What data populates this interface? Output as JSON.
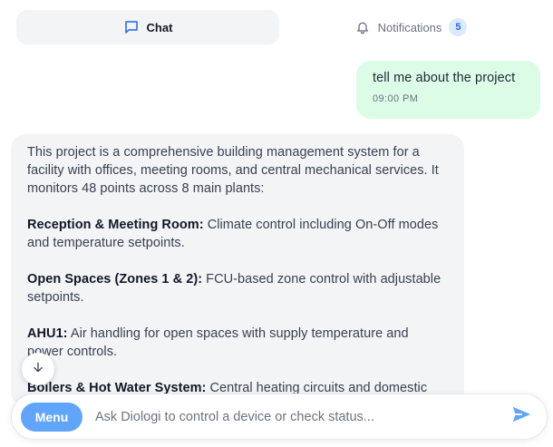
{
  "tabs": {
    "chat": {
      "label": "Chat",
      "icon": "chat-bubble-icon"
    },
    "notifications": {
      "label": "Notifications",
      "icon": "bell-icon",
      "count": "5"
    }
  },
  "messages": {
    "user": {
      "text": "tell me about the project",
      "time": "09:00 PM"
    },
    "assistant": {
      "intro": "This project is a comprehensive building management system for a facility with offices, meeting rooms, and central mechanical services. It monitors 48 points across 8 main plants:",
      "sections": [
        {
          "title": "Reception & Meeting Room:",
          "text": "Climate control including On-Off modes and temperature setpoints."
        },
        {
          "title": "Open Spaces (Zones 1 & 2):",
          "text": "FCU-based zone control with adjustable setpoints."
        },
        {
          "title": "AHU1:",
          "text": "Air handling for open spaces with supply temperature and power controls."
        },
        {
          "title": "Boilers & Hot Water System:",
          "text": "Central heating circuits and domestic"
        }
      ]
    }
  },
  "composer": {
    "menu_label": "Menu",
    "placeholder": "Ask Diologi to control a device or check status...",
    "send_icon": "send-icon"
  },
  "colors": {
    "accent": "#60a5fa",
    "user_bubble": "#dcfce7",
    "assistant_bubble": "#f3f4f6",
    "badge_text": "#2563eb"
  }
}
